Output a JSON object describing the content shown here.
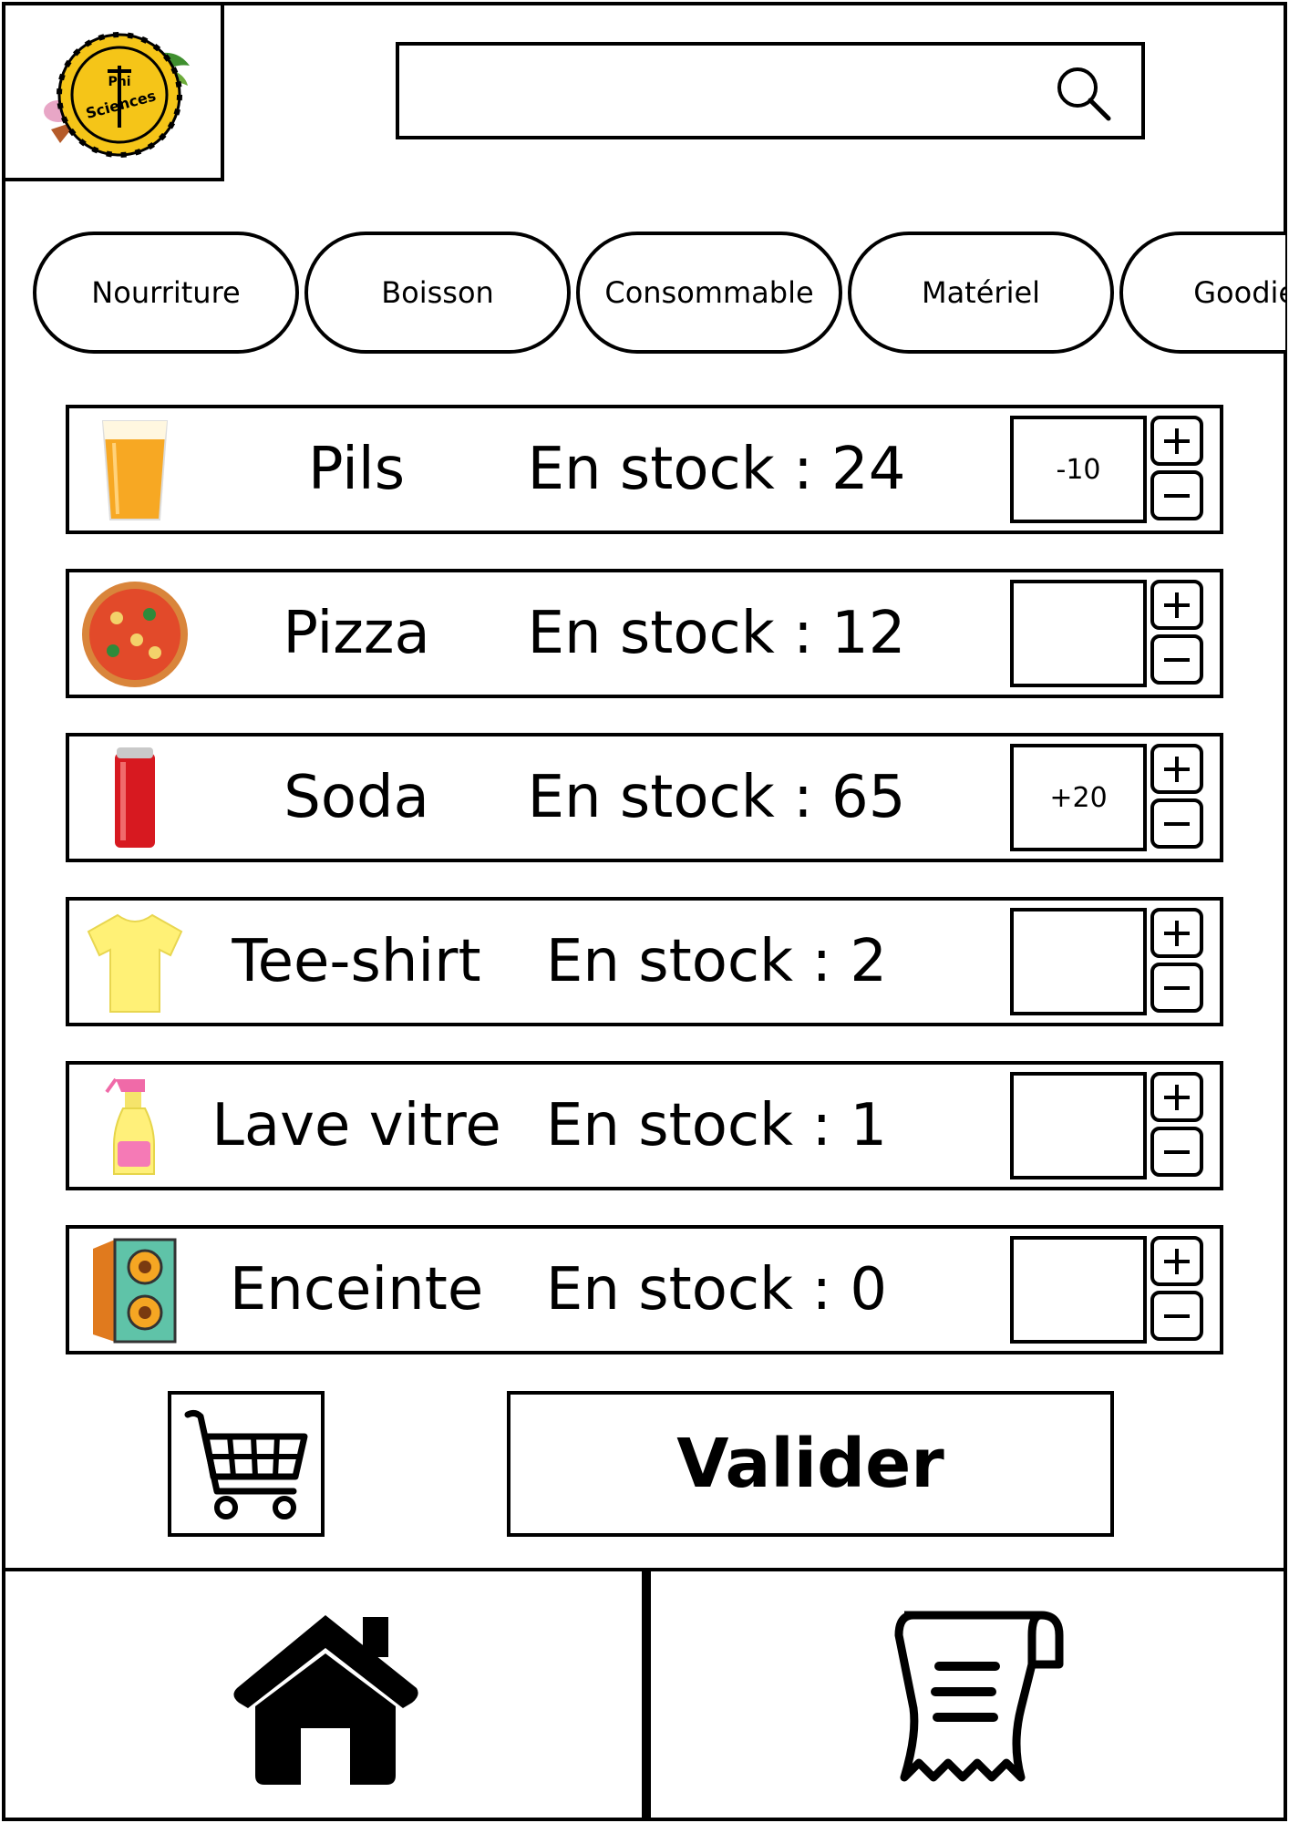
{
  "search": {
    "placeholder": ""
  },
  "categories": [
    "Nourriture",
    "Boisson",
    "Consommable",
    "Matériel",
    "Goodies"
  ],
  "products": [
    {
      "name": "Pils",
      "stock": "En stock : 24",
      "qty": "-10",
      "icon": "beer-glass-icon"
    },
    {
      "name": "Pizza",
      "stock": "En stock : 12",
      "qty": "",
      "icon": "pizza-icon"
    },
    {
      "name": "Soda",
      "stock": "En stock : 65",
      "qty": "+20",
      "icon": "soda-can-icon"
    },
    {
      "name": "Tee-shirt",
      "stock": "En stock : 2",
      "qty": "",
      "icon": "tee-shirt-icon"
    },
    {
      "name": "Lave vitre",
      "stock": "En stock : 1",
      "qty": "",
      "icon": "spray-bottle-icon"
    },
    {
      "name": "Enceinte",
      "stock": "En stock : 0",
      "qty": "",
      "icon": "speaker-icon"
    }
  ],
  "actions": {
    "validate_label": "Valider"
  },
  "nav": {
    "home": "home-icon",
    "receipt": "receipt-icon"
  },
  "colors": {
    "border": "#000000",
    "background": "#ffffff",
    "logo_yellow": "#f5c518"
  }
}
